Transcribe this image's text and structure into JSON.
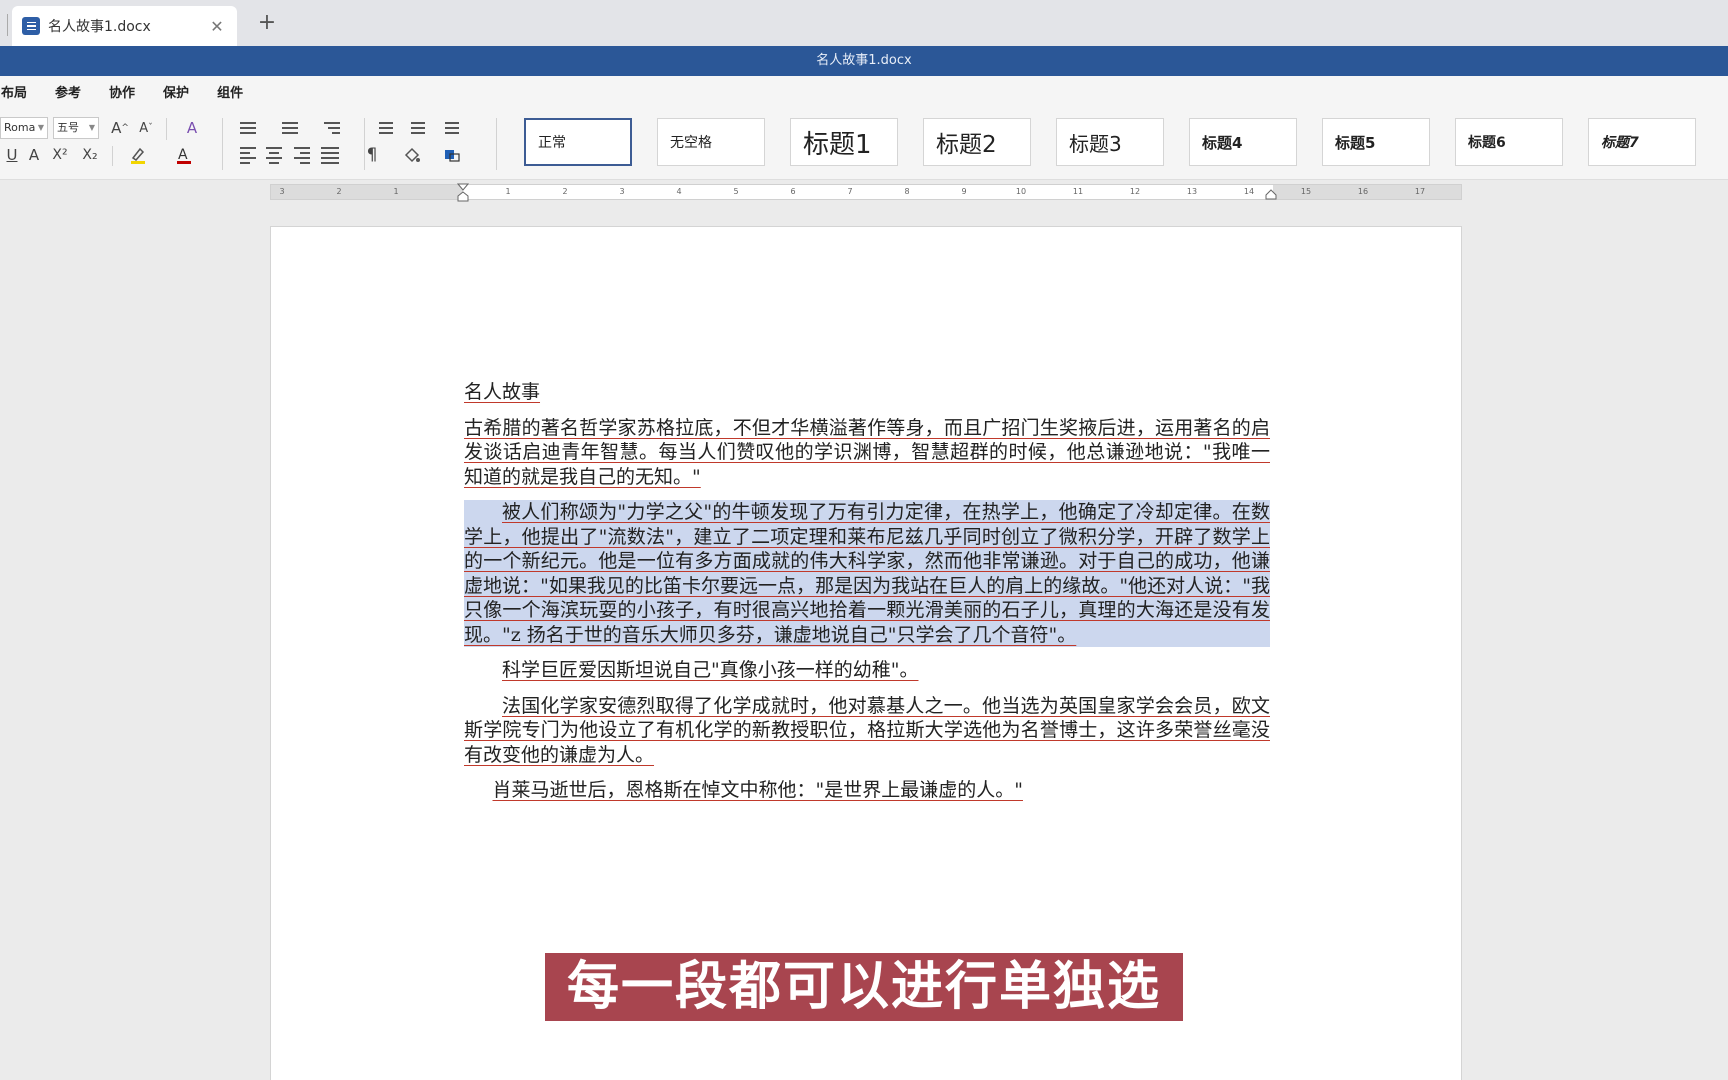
{
  "tab": {
    "title": "名人故事1.docx",
    "close": "✕",
    "new_tab": "+"
  },
  "titlebar": {
    "title": "名人故事1.docx"
  },
  "menus": [
    "布局",
    "参考",
    "协作",
    "保护",
    "组件"
  ],
  "toolbar": {
    "font_name": "Roma",
    "font_size": "五号",
    "grow_font": "A^",
    "shrink_font": "Aˇ",
    "underline": "U",
    "strike": "A",
    "superscript": "X²",
    "subscript": "X₂",
    "font_color_glyph": "A",
    "paragraph_mark": "¶"
  },
  "styles": [
    "正常",
    "无空格",
    "标题1",
    "标题2",
    "标题3",
    "标题4",
    "标题5",
    "标题6",
    "标题7"
  ],
  "ruler": {
    "ticks": [
      "3",
      "2",
      "1",
      "1",
      "2",
      "3",
      "4",
      "5",
      "6",
      "7",
      "8",
      "9",
      "10",
      "11",
      "12",
      "13",
      "14",
      "15",
      "16",
      "17"
    ]
  },
  "document": {
    "title": "名人故事",
    "p1": "古希腊的著名哲学家苏格拉底，不但才华横溢著作等身，而且广招门生奖掖后进，运用著名的启发谈话启迪青年智慧。每当人们赞叹他的学识渊博，智慧超群的时候，他总谦逊地说：\"我唯一知道的就是我自己的无知。\"",
    "p2": "被人们称颂为\"力学之父\"的牛顿发现了万有引力定律，在热学上，他确定了冷却定律。在数学上，他提出了\"流数法\"，建立了二项定理和莱布尼兹几乎同时创立了微积分学，开辟了数学上的一个新纪元。他是一位有多方面成就的伟大科学家，然而他非常谦逊。对于自己的成功，他谦虚地说：\"如果我见的比笛卡尔要远一点，那是因为我站在巨人的肩上的缘故。\"他还对人说：\"我只像一个海滨玩耍的小孩子，有时很高兴地拾着一颗光滑美丽的石子儿，真理的大海还是没有发现。\"z          扬名于世的音乐大师贝多芬，谦虚地说自己\"只学会了几个音符\"。",
    "p3": "科学巨匠爱因斯坦说自己\"真像小孩一样的幼稚\"。",
    "p4": "法国化学家安德烈取得了化学成就时，他对慕基人之一。他当选为英国皇家学会会员，欧文斯学院专门为他设立了有机化学的新教授职位，格拉斯大学选他为名誉博士，这许多荣誉丝毫没有改变他的谦虚为人。",
    "p5": "肖莱马逝世后，恩格斯在悼文中称他：\"是世界上最谦虚的人。\""
  },
  "caption": "每一段都可以进行单独选中",
  "colors": {
    "titlebar": "#2b5797",
    "selection": "#ccd7ee",
    "caption_bg": "#a8454f",
    "underline": "#c0392b"
  }
}
